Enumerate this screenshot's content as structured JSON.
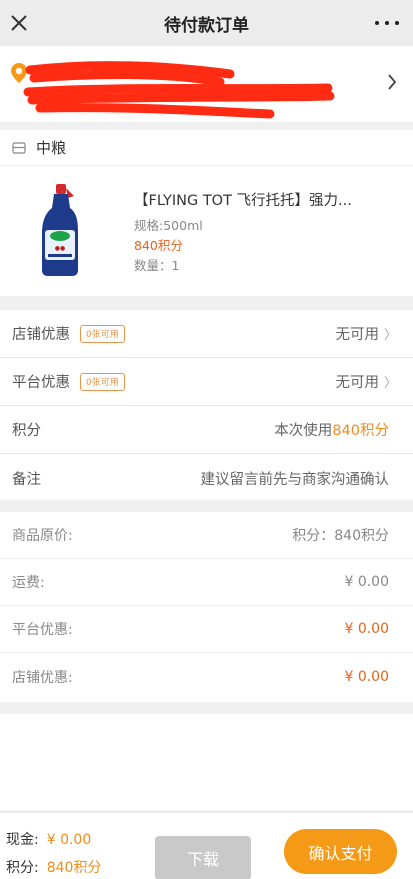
{
  "header": {
    "title": "待付款订单"
  },
  "shop": {
    "name": "中粮",
    "product": {
      "title": "【FLYING TOT 飞行托托】强力...",
      "spec": "规格:500ml",
      "points": "840积分",
      "quantity": "数量：1"
    }
  },
  "options": {
    "store_coupon": {
      "label": "店铺优惠",
      "badge": "0张可用",
      "value": "无可用"
    },
    "platform_coupon": {
      "label": "平台优惠",
      "badge": "0张可用",
      "value": "无可用"
    },
    "points": {
      "label": "积分",
      "value_prefix": "本次使用",
      "value_highlight": "840积分"
    },
    "remark": {
      "label": "备注",
      "placeholder": "建议留言前先与商家沟通确认"
    }
  },
  "summary": [
    {
      "label": "商品原价:",
      "value": "积分：840积分"
    },
    {
      "label": "运费:",
      "value": "¥ 0.00"
    },
    {
      "label": "平台优惠:",
      "value": "¥ 0.00"
    },
    {
      "label": "店铺优惠:",
      "value": "¥ 0.00"
    }
  ],
  "bottom": {
    "cash_label": "现金:",
    "cash_value": "¥ 0.00",
    "points_label": "积分:",
    "points_value": "840积分",
    "download_label": "下载",
    "confirm_label": "确认支付"
  },
  "colors": {
    "accent": "#f59a16",
    "points_orange": "#e8631c",
    "disabled_button": "#c9c9c9"
  },
  "icons": {
    "close": "close-icon",
    "more": "more-icon",
    "location": "location-pin-icon",
    "arrow": "chevron-right-icon",
    "store": "store-icon"
  }
}
